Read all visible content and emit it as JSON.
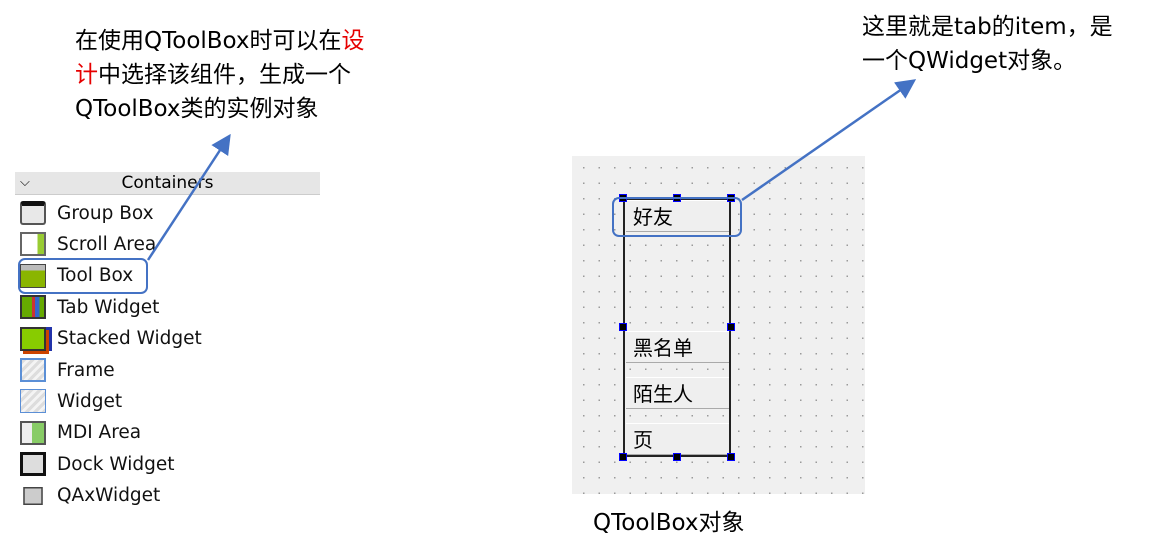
{
  "annotations": {
    "left": {
      "line1_a": "在使用QToolBox时可以在",
      "line1_red": "设",
      "line2_red": "计",
      "line2_b": "中选择该组件，生成一个",
      "line3": "QToolBox类的实例对象"
    },
    "right": {
      "line1": "这里就是tab的item，是",
      "line2": "一个QWidget对象。"
    },
    "accent": "#4472c4",
    "highlight_text": "#e60000"
  },
  "widget_box": {
    "category": "Containers",
    "items": [
      {
        "label": "Group Box",
        "icon": "group-box-icon"
      },
      {
        "label": "Scroll Area",
        "icon": "scroll-area-icon"
      },
      {
        "label": "Tool Box",
        "icon": "tool-box-icon",
        "highlighted": true
      },
      {
        "label": "Tab Widget",
        "icon": "tab-widget-icon"
      },
      {
        "label": "Stacked Widget",
        "icon": "stacked-widget-icon"
      },
      {
        "label": "Frame",
        "icon": "frame-icon"
      },
      {
        "label": "Widget",
        "icon": "widget-icon"
      },
      {
        "label": "MDI Area",
        "icon": "mdi-area-icon"
      },
      {
        "label": "Dock Widget",
        "icon": "dock-widget-icon"
      },
      {
        "label": "QAxWidget",
        "icon": "qaxwidget-icon"
      }
    ]
  },
  "designer": {
    "tabs": [
      "好友",
      "黑名单",
      "陌生人",
      "页"
    ],
    "caption": "QToolBox对象"
  }
}
